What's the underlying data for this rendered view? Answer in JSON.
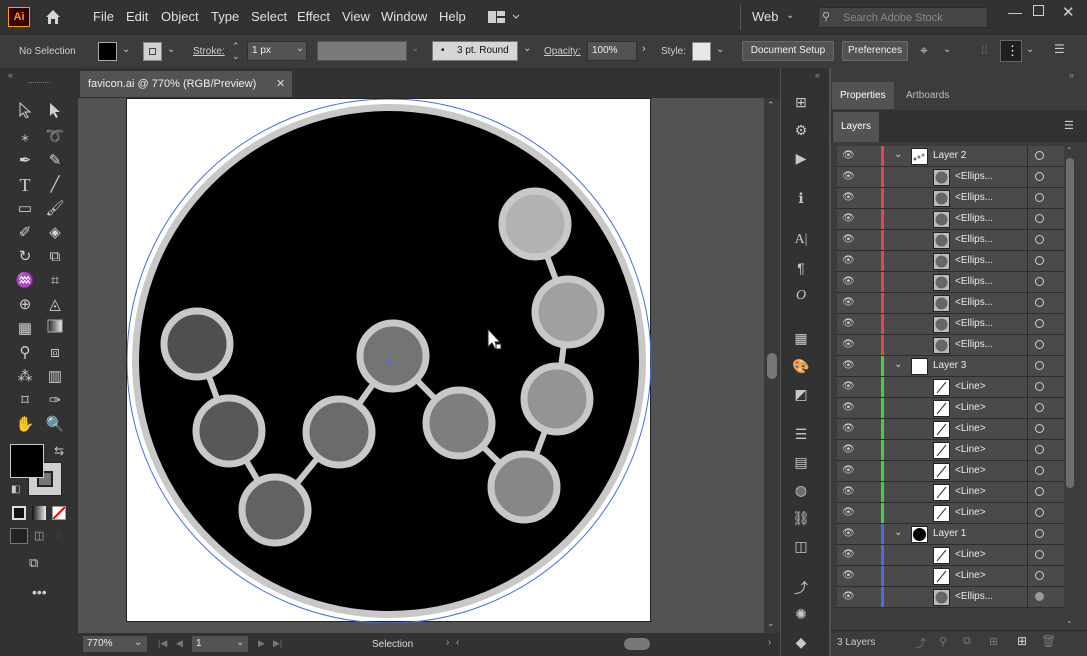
{
  "app": {
    "logo": "Ai",
    "workspace": "Web",
    "search_placeholder": "Search Adobe Stock"
  },
  "menu": [
    "File",
    "Edit",
    "Object",
    "Type",
    "Select",
    "Effect",
    "View",
    "Window",
    "Help"
  ],
  "control": {
    "selection": "No Selection",
    "stroke_label": "Stroke:",
    "stroke_value": "1 px",
    "brush": "3 pt. Round",
    "opacity_label": "Opacity:",
    "opacity_value": "100%",
    "style_label": "Style:",
    "document_setup": "Document Setup",
    "preferences": "Preferences"
  },
  "document": {
    "tab_title": "favicon.ai @ 770% (RGB/Preview)",
    "zoom": "770%",
    "artboard": "1",
    "status_tool": "Selection"
  },
  "panel": {
    "tabs": [
      "Properties",
      "Artboards"
    ],
    "layers_tab": "Layers",
    "footer_count": "3 Layers"
  },
  "layers": [
    {
      "name": "Layer 2",
      "type": "layer",
      "color": "#e24a4a"
    },
    {
      "name": "<Ellips...",
      "type": "item",
      "color": "#e24a4a"
    },
    {
      "name": "<Ellips...",
      "type": "item",
      "color": "#e24a4a"
    },
    {
      "name": "<Ellips...",
      "type": "item",
      "color": "#e24a4a"
    },
    {
      "name": "<Ellips...",
      "type": "item",
      "color": "#e24a4a"
    },
    {
      "name": "<Ellips...",
      "type": "item",
      "color": "#e24a4a"
    },
    {
      "name": "<Ellips...",
      "type": "item",
      "color": "#e24a4a"
    },
    {
      "name": "<Ellips...",
      "type": "item",
      "color": "#e24a4a"
    },
    {
      "name": "<Ellips...",
      "type": "item",
      "color": "#e24a4a"
    },
    {
      "name": "<Ellips...",
      "type": "item",
      "color": "#e24a4a"
    },
    {
      "name": "Layer 3",
      "type": "layer",
      "color": "#3fd43f"
    },
    {
      "name": "<Line>",
      "type": "item",
      "color": "#3fd43f"
    },
    {
      "name": "<Line>",
      "type": "item",
      "color": "#3fd43f"
    },
    {
      "name": "<Line>",
      "type": "item",
      "color": "#3fd43f"
    },
    {
      "name": "<Line>",
      "type": "item",
      "color": "#3fd43f"
    },
    {
      "name": "<Line>",
      "type": "item",
      "color": "#3fd43f"
    },
    {
      "name": "<Line>",
      "type": "item",
      "color": "#3fd43f"
    },
    {
      "name": "<Line>",
      "type": "item",
      "color": "#3fd43f"
    },
    {
      "name": "Layer 1",
      "type": "layer",
      "color": "#4a6ee2"
    },
    {
      "name": "<Line>",
      "type": "item",
      "color": "#4a6ee2"
    },
    {
      "name": "<Line>",
      "type": "item",
      "color": "#4a6ee2"
    },
    {
      "name": "<Ellips...",
      "type": "item",
      "color": "#4a6ee2"
    }
  ]
}
